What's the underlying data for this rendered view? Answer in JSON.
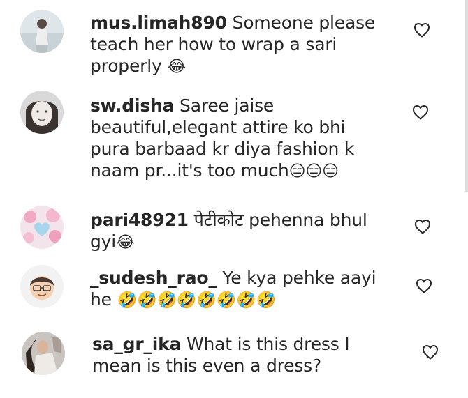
{
  "comments": [
    {
      "username": "mus.limah890",
      "text": "Someone please teach her how to wrap a sari properly",
      "emoji": "😂"
    },
    {
      "username": "sw.disha",
      "text": "Saree jaise beautiful,elegant attire ko bhi pura barbaad kr diya fashion k naam pr...it's too much",
      "emoji": "😑😑😑"
    },
    {
      "username": "pari48921",
      "text": "पेटीकोट pehenna bhul gyi",
      "emoji": "😂"
    },
    {
      "username": "_sudesh_rao_",
      "text": "Ye kya pehke aayi he",
      "emoji": "🤣🤣🤣🤣🤣🤣🤣🤣"
    },
    {
      "username": "sa_gr_ika",
      "text": "What is this dress I mean is this even a dress?",
      "emoji": ""
    }
  ],
  "icons": {
    "like": "heart-outline-icon"
  }
}
